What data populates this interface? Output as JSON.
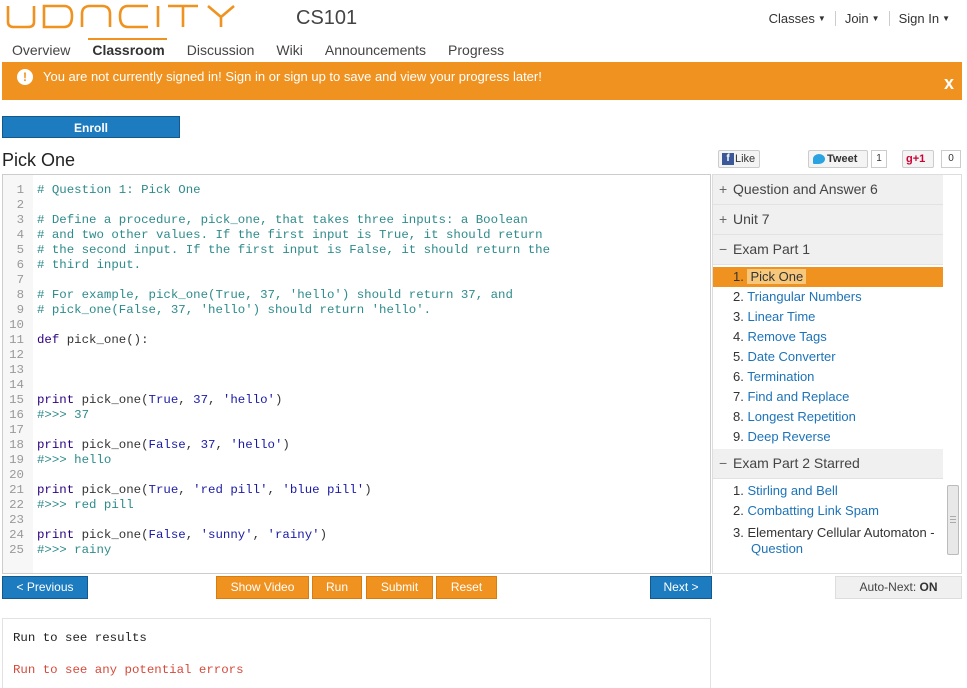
{
  "brand": {
    "course": "CS101",
    "logo_text": "UDACITY",
    "accent": "#f0921f",
    "link": "#1d73b8"
  },
  "top_nav": [
    {
      "label": "Classes"
    },
    {
      "label": "Join"
    },
    {
      "label": "Sign In"
    }
  ],
  "tabs": [
    "Overview",
    "Classroom",
    "Discussion",
    "Wiki",
    "Announcements",
    "Progress"
  ],
  "alert": {
    "text": "You are not currently signed in! Sign in or sign up to save and view your progress later!",
    "close": "x"
  },
  "enroll_label": "Enroll",
  "page_title": "Pick One",
  "social": {
    "like": "Like",
    "tweet": "Tweet",
    "tweet_count": "1",
    "gplus": "+1",
    "gplus_count": "0"
  },
  "code_lines": [
    "# Question 1: Pick One",
    "",
    "# Define a procedure, pick_one, that takes three inputs: a Boolean",
    "# and two other values. If the first input is True, it should return",
    "# the second input. If the first input is False, it should return the",
    "# third input.",
    "",
    "# For example, pick_one(True, 37, 'hello') should return 37, and",
    "# pick_one(False, 37, 'hello') should return 'hello'.",
    "",
    "def pick_one():",
    "",
    "",
    "",
    "print pick_one(True, 37, 'hello')",
    "#>>> 37",
    "",
    "print pick_one(False, 37, 'hello')",
    "#>>> hello",
    "",
    "print pick_one(True, 'red pill', 'blue pill')",
    "#>>> red pill",
    "",
    "print pick_one(False, 'sunny', 'rainy')",
    "#>>> rainy"
  ],
  "sidebar": {
    "sections": [
      {
        "title": "Question and Answer 6",
        "sign": "+"
      },
      {
        "title": "Unit 7",
        "sign": "+"
      },
      {
        "title": "Exam Part 1",
        "sign": "−"
      }
    ],
    "exam1_items": [
      {
        "num": "1.",
        "label": "Pick One"
      },
      {
        "num": "2.",
        "label": "Triangular Numbers"
      },
      {
        "num": "3.",
        "label": "Linear Time"
      },
      {
        "num": "4.",
        "label": "Remove Tags"
      },
      {
        "num": "5.",
        "label": "Date Converter"
      },
      {
        "num": "6.",
        "label": "Termination"
      },
      {
        "num": "7.",
        "label": "Find and Replace"
      },
      {
        "num": "8.",
        "label": "Longest Repetition"
      },
      {
        "num": "9.",
        "label": "Deep Reverse"
      }
    ],
    "exam2_title": "Exam Part 2 Starred",
    "exam2_sign": "−",
    "exam2_items": [
      {
        "num": "1.",
        "label": "Stirling and Bell"
      },
      {
        "num": "2.",
        "label": "Combatting Link Spam"
      }
    ],
    "exam2_item3": {
      "num": "3.",
      "label": "Elementary Cellular Automaton -",
      "sub": "Question"
    }
  },
  "buttons": {
    "previous": "< Previous",
    "show_video": "Show Video",
    "run": "Run",
    "submit": "Submit",
    "reset": "Reset",
    "next": "Next >",
    "autonext_label": "Auto-Next:",
    "autonext_value": "ON"
  },
  "output": {
    "results": "Run to see results",
    "errors": "Run to see any potential errors"
  }
}
